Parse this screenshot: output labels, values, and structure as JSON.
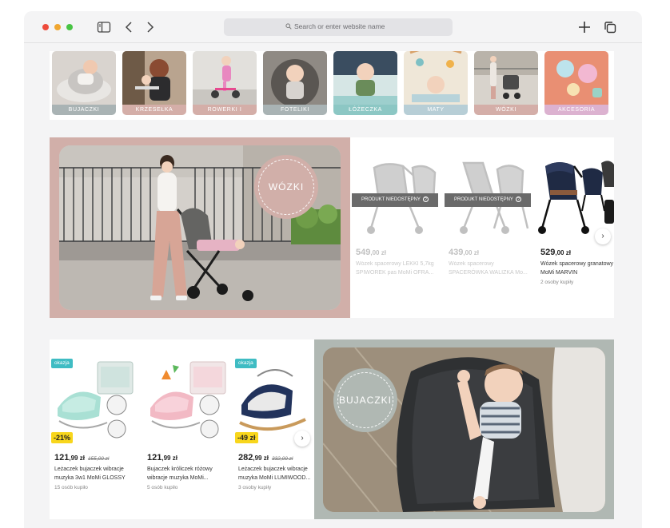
{
  "browser": {
    "url_placeholder": "Search or enter website name"
  },
  "categories": [
    {
      "label": "BUJACZKI",
      "color": "#a9b3b4"
    },
    {
      "label": "KRZESEŁKA",
      "color": "#d4aea8"
    },
    {
      "label": "ROWERKI I POJAZDY",
      "color": "#d4aea8"
    },
    {
      "label": "FOTELIKI",
      "color": "#a9b3b4"
    },
    {
      "label": "ŁÓŻECZKA",
      "color": "#8cc7c4"
    },
    {
      "label": "MATY",
      "color": "#b7ced6"
    },
    {
      "label": "WÓZKI",
      "color": "#d4aea8"
    },
    {
      "label": "AKCESORIA",
      "color": "#dcb2d0"
    }
  ],
  "stroller_section": {
    "banner_label": "WÓZKI",
    "banner_color": "#d1afa9",
    "unavailable_label": "PRODUKT NIEDOSTĘPNY",
    "products": [
      {
        "price_main": "549",
        "price_cents": ",00 zł",
        "name_line1": "Wózek spacerowy LEKKI 5,7kg",
        "name_line2": "SPIWOREK pas MoMi OFRA...",
        "bought": ""
      },
      {
        "price_main": "439",
        "price_cents": ",00 zł",
        "name_line1": "Wózek spacerowy",
        "name_line2": "SPACERÓWKA WALIZKA Mo...",
        "bought": ""
      },
      {
        "price_main": "529",
        "price_cents": ",00 zł",
        "name_line1": "Wózek spacerowy granatowy",
        "name_line2": "MoMi MARVIN",
        "bought": "2 osoby kupiły"
      }
    ]
  },
  "bouncer_section": {
    "banner_label": "BUJACZKI",
    "banner_color": "#b0b8b3",
    "okazja_label": "okazja",
    "products": [
      {
        "price_main": "121",
        "price_cents": ",99 zł",
        "old_price": "155,00 zł",
        "discount": "-21%",
        "name_line1": "Leżaczek bujaczek wibracje",
        "name_line2": "muzyka 3w1 MoMi GLOSSY",
        "bought": "15 osób kupiło"
      },
      {
        "price_main": "121",
        "price_cents": ",99 zł",
        "old_price": "",
        "discount": "",
        "name_line1": "Bujaczek króliczek różowy",
        "name_line2": "wibracje muzyka MoMi...",
        "bought": "5 osób kupiło"
      },
      {
        "price_main": "282",
        "price_cents": ",99 zł",
        "old_price": "332,00 zł",
        "discount": "-49 zł",
        "name_line1": "Leżaczek bujaczek wibracje",
        "name_line2": "muzyka MoMi LUMIWOOD...",
        "bought": "3 osoby kupiły"
      }
    ]
  }
}
